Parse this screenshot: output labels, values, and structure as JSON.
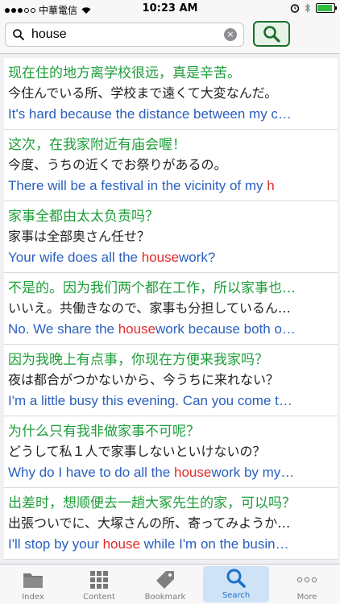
{
  "status_bar": {
    "carrier": "中華電信",
    "time": "10:23 AM"
  },
  "search": {
    "query": "house",
    "clear_label": "×"
  },
  "results": [
    {
      "cn": "现在住的地方离学校很远，真是辛苦。",
      "jp": "今住んでいる所、学校まで遠くて大変なんだ。",
      "en": [
        {
          "t": "It's hard because the distance between my c…",
          "h": false
        }
      ]
    },
    {
      "cn": "这次，在我家附近有庙会喔！",
      "jp": "今度、うちの近くでお祭りがあるの。",
      "en": [
        {
          "t": "There will be a festival in the vicinity of my ",
          "h": false
        },
        {
          "t": "h",
          "h": true
        }
      ]
    },
    {
      "cn": "家事全都由太太负责吗？",
      "jp": "家事は全部奥さん任せ？",
      "en": [
        {
          "t": "Your wife does all the ",
          "h": false
        },
        {
          "t": "house",
          "h": true
        },
        {
          "t": "work?",
          "h": false
        }
      ]
    },
    {
      "cn": "不是的。因为我们两个都在工作，所以家事也…",
      "jp": "いいえ。共働きなので、家事も分担しているん…",
      "en": [
        {
          "t": "No. We share the ",
          "h": false
        },
        {
          "t": "house",
          "h": true
        },
        {
          "t": "work because both o…",
          "h": false
        }
      ]
    },
    {
      "cn": "因为我晚上有点事，你现在方便来我家吗？",
      "jp": "夜は都合がつかないから、今うちに来れない？",
      "en": [
        {
          "t": "I'm a little busy this evening. Can you come t…",
          "h": false
        }
      ]
    },
    {
      "cn": "为什么只有我非做家事不可呢？",
      "jp": "どうして私１人で家事しないといけないの？",
      "en": [
        {
          "t": "Why do I have to do all the ",
          "h": false
        },
        {
          "t": "house",
          "h": true
        },
        {
          "t": "work by my…",
          "h": false
        }
      ]
    },
    {
      "cn": "出差时，想顺便去一趟大冢先生的家，可以吗？",
      "jp": "出張ついでに、大塚さんの所、寄ってみようか…",
      "en": [
        {
          "t": "I'll stop by your ",
          "h": false
        },
        {
          "t": "house",
          "h": true
        },
        {
          "t": " while I'm on the busin…",
          "h": false
        }
      ]
    }
  ],
  "tabs": [
    {
      "label": "Index",
      "icon": "folder-icon",
      "active": false
    },
    {
      "label": "Content",
      "icon": "grid-icon",
      "active": false
    },
    {
      "label": "Bookmark",
      "icon": "bookmark-tag-icon",
      "active": false
    },
    {
      "label": "Search",
      "icon": "search-icon",
      "active": true
    },
    {
      "label": "More",
      "icon": "more-icon",
      "active": false
    }
  ],
  "colors": {
    "cn": "#1e9e3a",
    "en": "#2a5fbf",
    "highlight": "#e02b2b",
    "accent": "#1e6fc9",
    "search_button_border": "#1d6e2b"
  }
}
